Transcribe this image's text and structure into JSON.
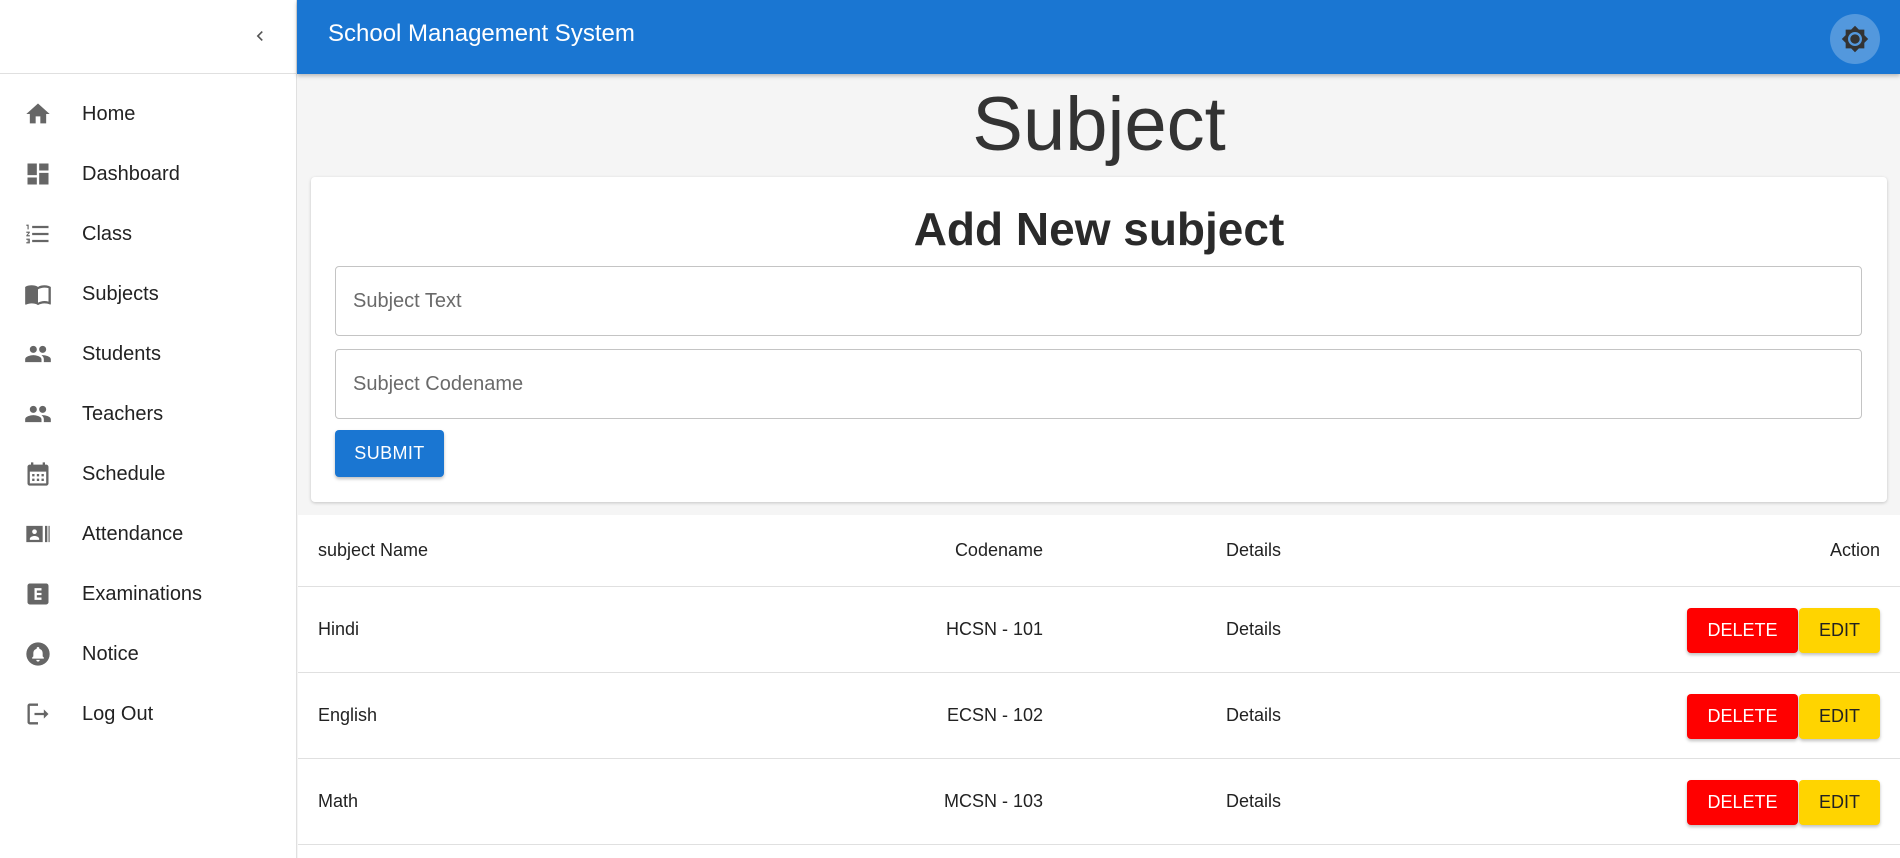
{
  "app": {
    "title": "School Management System"
  },
  "sidebar": {
    "items": [
      {
        "label": "Home",
        "icon": "home-icon"
      },
      {
        "label": "Dashboard",
        "icon": "dashboard-icon"
      },
      {
        "label": "Class",
        "icon": "list-icon"
      },
      {
        "label": "Subjects",
        "icon": "book-icon"
      },
      {
        "label": "Students",
        "icon": "people-icon"
      },
      {
        "label": "Teachers",
        "icon": "people-icon"
      },
      {
        "label": "Schedule",
        "icon": "calendar-icon"
      },
      {
        "label": "Attendance",
        "icon": "id-card-icon"
      },
      {
        "label": "Examinations",
        "icon": "exam-icon"
      },
      {
        "label": "Notice",
        "icon": "bell-icon"
      },
      {
        "label": "Log Out",
        "icon": "logout-icon"
      }
    ]
  },
  "page": {
    "title": "Subject"
  },
  "form": {
    "title": "Add New subject",
    "subject_text_placeholder": "Subject Text",
    "subject_codename_placeholder": "Subject Codename",
    "submit_label": "SUBMIT"
  },
  "table": {
    "headers": {
      "name": "subject Name",
      "code": "Codename",
      "details": "Details",
      "action": "Action"
    },
    "rows": [
      {
        "name": "Hindi",
        "code": "HCSN - 101",
        "details": "Details",
        "delete": "DELETE",
        "edit": "EDIT"
      },
      {
        "name": "English",
        "code": "ECSN - 102",
        "details": "Details",
        "delete": "DELETE",
        "edit": "EDIT"
      },
      {
        "name": "Math",
        "code": "MCSN - 103",
        "details": "Details",
        "delete": "DELETE",
        "edit": "EDIT"
      }
    ]
  },
  "colors": {
    "primary": "#1a76d2",
    "delete": "#ff0000",
    "edit": "#ffd400"
  }
}
